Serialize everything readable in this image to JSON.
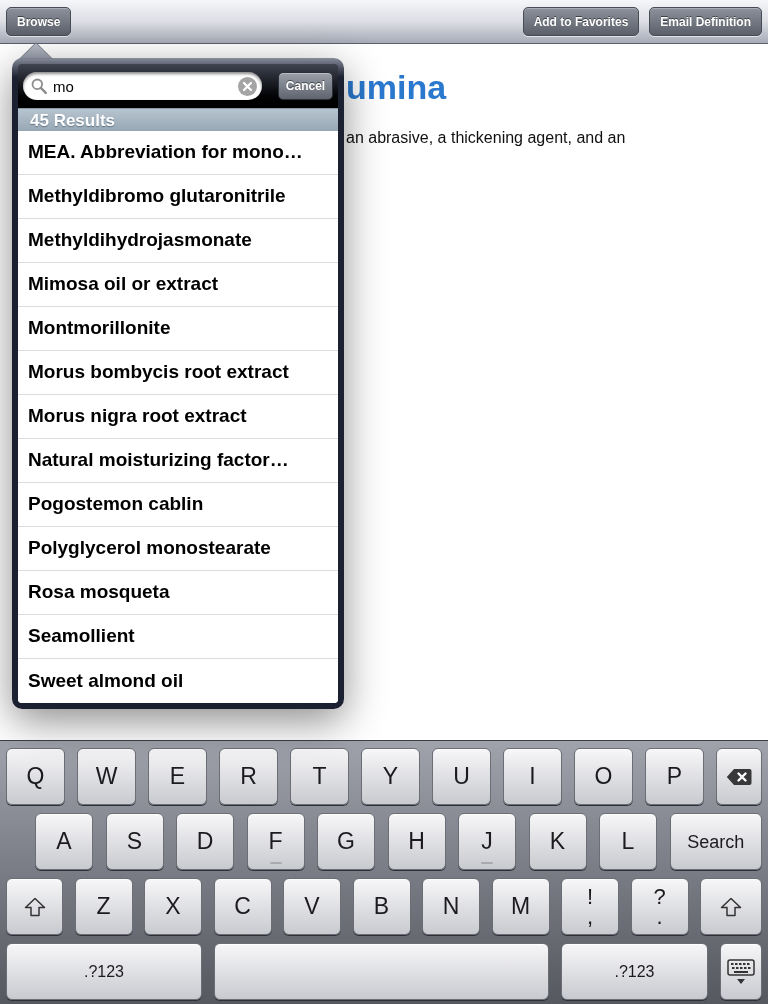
{
  "toolbar": {
    "left_buttons": [
      "Browse"
    ],
    "right_buttons": [
      "Add to Favorites",
      "Email Definition"
    ]
  },
  "definition": {
    "title": "umina",
    "text": "an abrasive, a thickening agent, and an"
  },
  "search_popover": {
    "search_field": {
      "value": "mo"
    },
    "cancel_button": "Cancel",
    "results_header": "45 Results",
    "results": [
      "MEA. Abbreviation for mono…",
      "Methyldibromo glutaronitrile",
      "Methyldihydrojasmonate",
      "Mimosa oil or extract",
      "Montmorillonite",
      "Morus bombycis root extract",
      "Morus nigra root extract",
      "Natural moisturizing factor…",
      "Pogostemon cablin",
      "Polyglycerol monostearate",
      "Rosa mosqueta",
      "Seamollient",
      "Sweet almond oil"
    ]
  },
  "keyboard": {
    "rows": [
      {
        "keys": [
          {
            "kind": "letter",
            "label": "Q",
            "homing": false
          },
          {
            "kind": "letter",
            "label": "W",
            "homing": false
          },
          {
            "kind": "letter",
            "label": "E",
            "homing": false
          },
          {
            "kind": "letter",
            "label": "R",
            "homing": false
          },
          {
            "kind": "letter",
            "label": "T",
            "homing": false
          },
          {
            "kind": "letter",
            "label": "Y",
            "homing": false
          },
          {
            "kind": "letter",
            "label": "U",
            "homing": false
          },
          {
            "kind": "letter",
            "label": "I",
            "homing": false
          },
          {
            "kind": "letter",
            "label": "O",
            "homing": false
          },
          {
            "kind": "letter",
            "label": "P",
            "homing": false
          },
          {
            "kind": "backspace"
          }
        ]
      },
      {
        "keys": [
          {
            "kind": "letter",
            "label": "A",
            "homing": false
          },
          {
            "kind": "letter",
            "label": "S",
            "homing": false
          },
          {
            "kind": "letter",
            "label": "D",
            "homing": false
          },
          {
            "kind": "letter",
            "label": "F",
            "homing": true
          },
          {
            "kind": "letter",
            "label": "G",
            "homing": false
          },
          {
            "kind": "letter",
            "label": "H",
            "homing": false
          },
          {
            "kind": "letter",
            "label": "J",
            "homing": true
          },
          {
            "kind": "letter",
            "label": "K",
            "homing": false
          },
          {
            "kind": "letter",
            "label": "L",
            "homing": false
          },
          {
            "kind": "search",
            "label": "Search"
          }
        ]
      },
      {
        "keys": [
          {
            "kind": "shift"
          },
          {
            "kind": "letter",
            "label": "Z",
            "homing": false
          },
          {
            "kind": "letter",
            "label": "X",
            "homing": false
          },
          {
            "kind": "letter",
            "label": "C",
            "homing": false
          },
          {
            "kind": "letter",
            "label": "V",
            "homing": false
          },
          {
            "kind": "letter",
            "label": "B",
            "homing": false
          },
          {
            "kind": "letter",
            "label": "N",
            "homing": false
          },
          {
            "kind": "letter",
            "label": "M",
            "homing": false
          },
          {
            "kind": "dual",
            "top": "!",
            "bottom": ","
          },
          {
            "kind": "dual",
            "top": "?",
            "bottom": "."
          },
          {
            "kind": "shift"
          }
        ]
      },
      {
        "keys": [
          {
            "kind": "mode",
            "label": ".?123"
          },
          {
            "kind": "space"
          },
          {
            "kind": "mode",
            "label": ".?123"
          },
          {
            "kind": "hide"
          }
        ]
      }
    ]
  }
}
